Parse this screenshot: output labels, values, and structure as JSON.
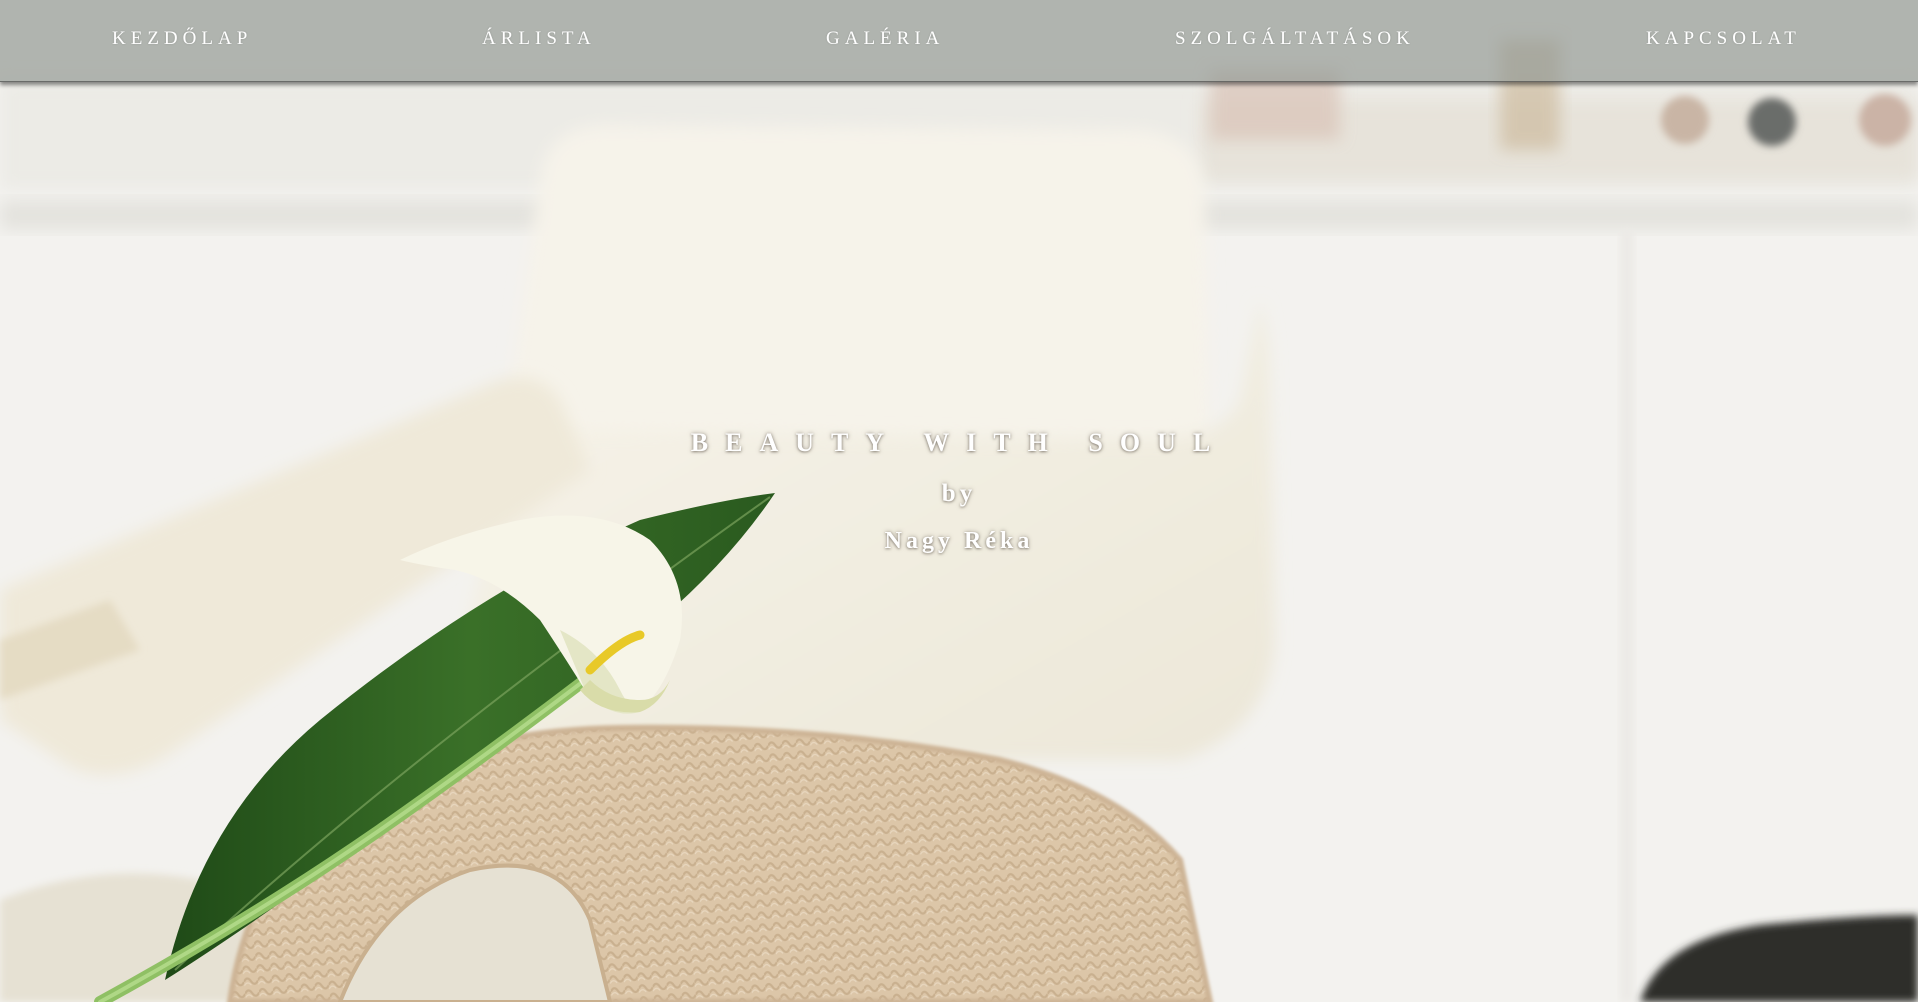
{
  "nav": {
    "home": "KEZDŐLAP",
    "prices": "ÁRLISTA",
    "gallery": "GALÉRIA",
    "services": "SZOLGÁLTATÁSOK",
    "contact": "KAPCSOLAT"
  },
  "hero": {
    "tagline": "BEAUTY WITH SOUL",
    "by": "by",
    "name": "Nagy Réka"
  },
  "colors": {
    "navbar_background": "#969b96",
    "nav_text": "#ffffff",
    "towel": "#dcc7ab",
    "leaf": "#2f5f25",
    "lily": "#f6f4e8"
  }
}
